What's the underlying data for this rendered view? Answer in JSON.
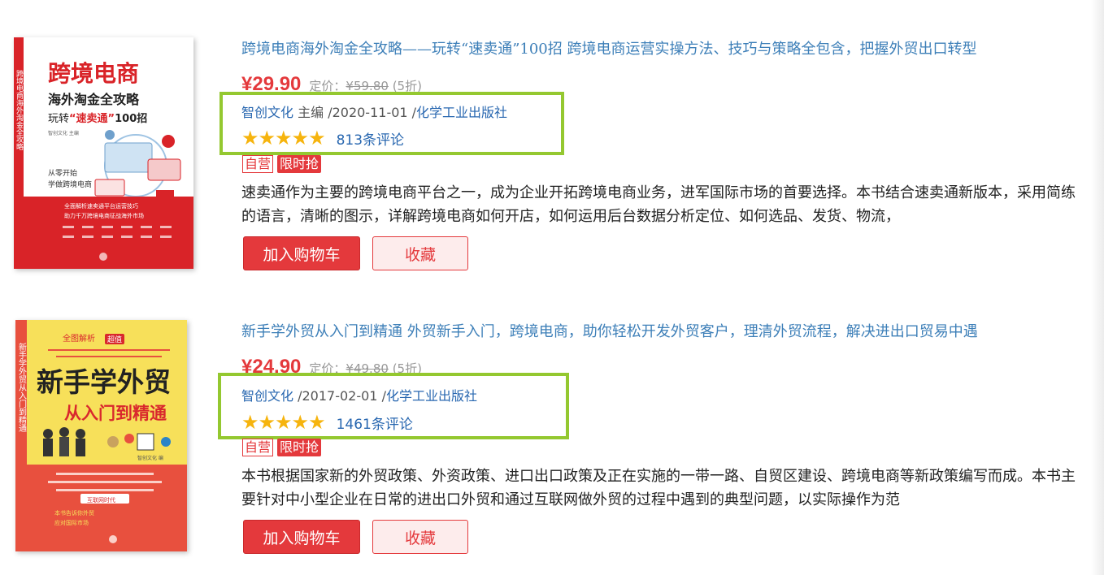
{
  "colors": {
    "accent": "#e4393c",
    "link": "#2867b0",
    "title": "#3d7fb8",
    "highlight": "#94c830",
    "star": "#f6b40e"
  },
  "products": [
    {
      "title": "跨境电商海外淘金全攻略——玩转“速卖通”100招 跨境电商运营实操方法、技巧与策略全包含，把握外贸出口转型",
      "price": "¥29.90",
      "orig_label": "定价：",
      "orig_price": "¥59.80",
      "discount": "(5折)",
      "author": "智创文化",
      "author_role": " 主编",
      "date": " /2020-11-01 /",
      "publisher": "化学工业出版社",
      "stars": "★★★★★",
      "rating": 5,
      "reviews": "813条评论",
      "tag_self": "自营",
      "tag_flash": "限时抢",
      "description": "速卖通作为主要的跨境电商平台之一，成为企业开拓跨境电商业务，进军国际市场的首要选择。本书结合速卖通新版本，采用简练的语言，清晰的图示，详解跨境电商如何开店，如何运用后台数据分析定位、如何选品、发货、物流，",
      "cart_label": "加入购物车",
      "fav_label": "收藏",
      "cover": {
        "title_big": "跨境电商",
        "title_sub": "海外淘金全攻略",
        "line3_pre": "玩转",
        "line3_hl": "“速卖通”",
        "line3_post": "100招",
        "author": "智创文化 主编",
        "spine": "跨境电商海外淘金全攻略",
        "slogan1": "从零开始",
        "slogan2": "学做跨境电商",
        "band1": "全面解析速卖通平台运营技巧",
        "band2": "助力千万跨境电商征战海外市场"
      }
    },
    {
      "title": "新手学外贸从入门到精通 外贸新手入门，跨境电商，助你轻松开发外贸客户，理清外贸流程，解决进出口贸易中遇",
      "price": "¥24.90",
      "orig_label": "定价：",
      "orig_price": "¥49.80",
      "discount": "(5折)",
      "author": "智创文化",
      "author_role": "",
      "date": " /2017-02-01 /",
      "publisher": "化学工业出版社",
      "stars": "★★★★★",
      "rating": 5,
      "reviews": "1461条评论",
      "tag_self": "自营",
      "tag_flash": "限时抢",
      "description": "本书根据国家新的外贸政策、外资政策、进口出口政策及正在实施的一带一路、自贸区建设、跨境电商等新政策编写而成。本书主要针对中小型企业在日常的进出口外贸和通过互联网做外贸的过程中遇到的典型问题，以实际操作为范",
      "cart_label": "加入购物车",
      "fav_label": "收藏",
      "cover": {
        "top": "全图解析",
        "top_badge": "超值",
        "title_big": "新手学外贸",
        "title_sub": "从入门到精通",
        "author": "智创文化 编",
        "spine": "新手学外贸从入门到精通",
        "label": "互联网时代",
        "line1": "本书告诉你外贸",
        "line2": "应对国际市场"
      }
    }
  ]
}
